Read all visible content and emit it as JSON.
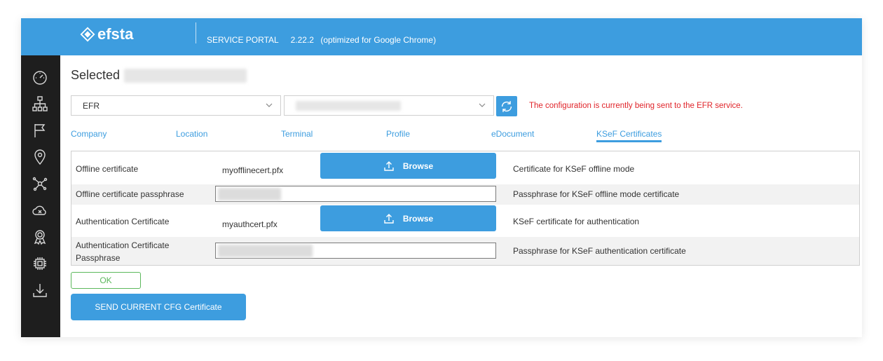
{
  "header": {
    "logo_text": "efsta",
    "portal_label": "SERVICE PORTAL",
    "version": "2.22.2",
    "optimized_note": "(optimized for Google Chrome)",
    "background_color": "#3d9ddf"
  },
  "sidebar": {
    "icons": [
      "dashboard-icon",
      "hierarchy-icon",
      "flag-icon",
      "location-pin-icon",
      "network-icon",
      "cloud-x-icon",
      "certificate-badge-icon",
      "chip-icon",
      "download-icon"
    ]
  },
  "main": {
    "selected_label": "Selected",
    "service_select": {
      "value": "EFR"
    },
    "warning_text": "The configuration is currently being sent to the EFR service.",
    "warning_color": "#e0242a",
    "tabs": [
      {
        "label": "Company",
        "active": false
      },
      {
        "label": "Location",
        "active": false
      },
      {
        "label": "Terminal",
        "active": false
      },
      {
        "label": "Profile",
        "active": false
      },
      {
        "label": "eDocument",
        "active": false
      },
      {
        "label": "KSeF Certificates",
        "active": true
      }
    ],
    "rows": [
      {
        "label": "Offline certificate",
        "file": "myofflinecert.pfx",
        "button_label": "Browse",
        "description": "Certificate for KSeF offline mode"
      },
      {
        "label": "Offline certificate passphrase",
        "description": "Passphrase for KSeF offline mode certificate"
      },
      {
        "label": "Authentication Certificate",
        "file": "myauthcert.pfx",
        "button_label": "Browse",
        "description": "KSeF certificate for authentication"
      },
      {
        "label": "Authentication Certificate Passphrase",
        "description": "Passphrase for KSeF authentication certificate"
      }
    ],
    "ok_label": "OK",
    "send_label": "SEND CURRENT CFG Certificate"
  }
}
